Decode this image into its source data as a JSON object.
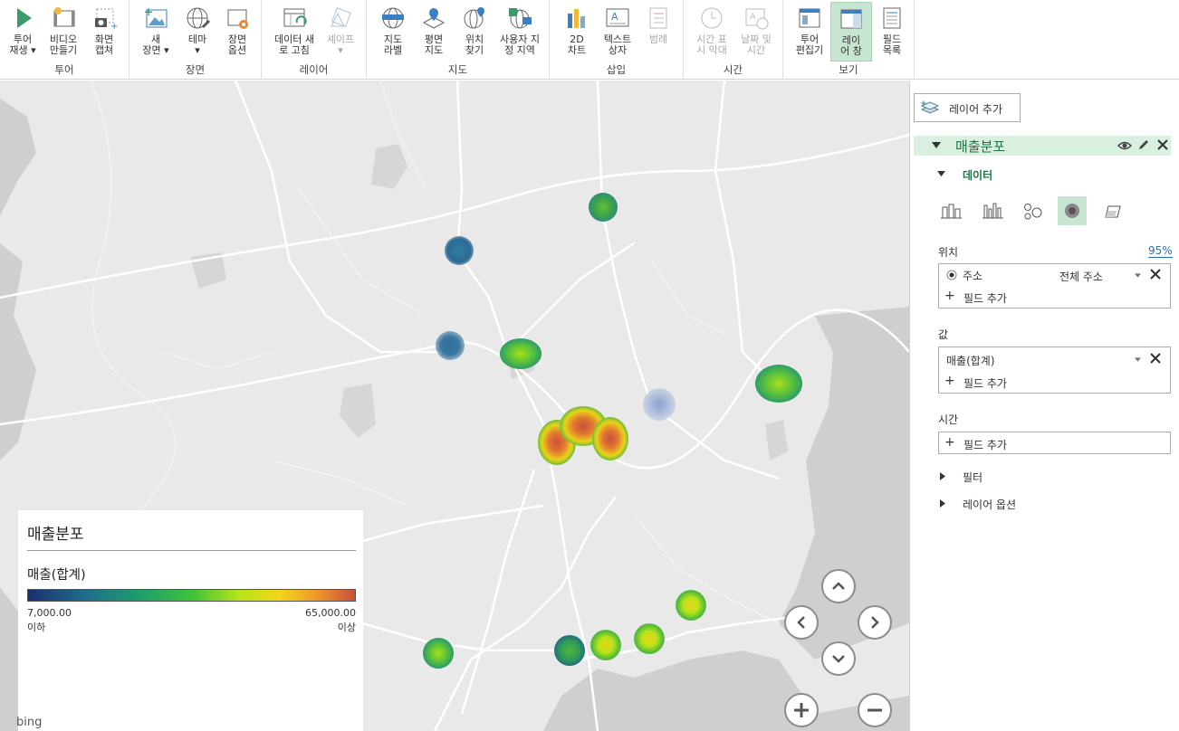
{
  "ribbon": {
    "groups": [
      {
        "label": "투어",
        "buttons": [
          {
            "l1": "투어",
            "l2": "재생 ▾"
          },
          {
            "l1": "비디오",
            "l2": "만들기"
          },
          {
            "l1": "화면",
            "l2": "캡쳐"
          }
        ]
      },
      {
        "label": "장면",
        "buttons": [
          {
            "l1": "새",
            "l2": "장면 ▾"
          },
          {
            "l1": "테마",
            "l2": "▾"
          },
          {
            "l1": "장면",
            "l2": "옵션"
          }
        ]
      },
      {
        "label": "레이어",
        "buttons": [
          {
            "l1": "데이터 새",
            "l2": "로 고침"
          },
          {
            "l1": "셰이프",
            "l2": "▾"
          }
        ]
      },
      {
        "label": "지도",
        "buttons": [
          {
            "l1": "지도",
            "l2": "라벨"
          },
          {
            "l1": "평면",
            "l2": "지도"
          },
          {
            "l1": "위치",
            "l2": "찾기"
          },
          {
            "l1": "사용자 지",
            "l2": "정 지역"
          }
        ]
      },
      {
        "label": "삽입",
        "buttons": [
          {
            "l1": "2D",
            "l2": "차트"
          },
          {
            "l1": "텍스트",
            "l2": "상자"
          },
          {
            "l1": "범례",
            "l2": ""
          }
        ]
      },
      {
        "label": "시간",
        "buttons": [
          {
            "l1": "시간 표",
            "l2": "시 막대"
          },
          {
            "l1": "날짜 및",
            "l2": "시간"
          }
        ]
      },
      {
        "label": "보기",
        "buttons": [
          {
            "l1": "투어",
            "l2": "편집기"
          },
          {
            "l1": "레이",
            "l2": "어 창"
          },
          {
            "l1": "필드",
            "l2": "목록"
          }
        ]
      }
    ]
  },
  "legend": {
    "title": "매출분포",
    "subtitle": "매출(합계)",
    "min_value": "7,000.00",
    "min_label": "이하",
    "max_value": "65,000.00",
    "max_label": "이상"
  },
  "map": {
    "attribution": "bing"
  },
  "panel": {
    "add_layer": "레이어 추가",
    "layer_name": "매출분포",
    "data_section": "데이터",
    "location_label": "위치",
    "location_pct": "95%",
    "location_field": "주소",
    "location_type": "전체 주소",
    "add_field": "필드 추가",
    "value_label": "값",
    "value_field": "매출(합계)",
    "time_label": "시간",
    "filter_label": "필터",
    "layer_options_label": "레이어 옵션"
  },
  "colors": {
    "accent": "#217346",
    "layer_header": "#d9efe0",
    "active_viz": "#c7e6d1"
  }
}
